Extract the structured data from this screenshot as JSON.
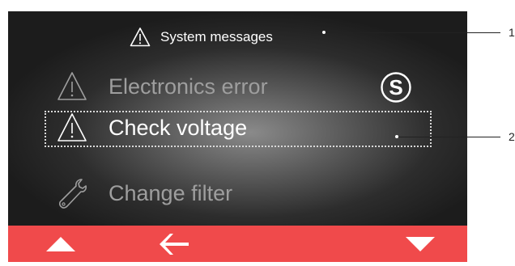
{
  "header": {
    "title": "System messages"
  },
  "messages": [
    {
      "label": "Electronics error",
      "icon": "warning-icon",
      "badge": "S",
      "selected": false
    },
    {
      "label": "Check voltage",
      "icon": "warning-icon",
      "selected": true
    },
    {
      "label": "Change filter",
      "icon": "wrench-icon",
      "selected": false
    }
  ],
  "footer": {
    "buttons": [
      {
        "name": "up-arrow-icon"
      },
      {
        "name": "back-arrow-icon"
      },
      {
        "name": "down-arrow-icon"
      }
    ]
  },
  "callouts": [
    "1",
    "2"
  ],
  "colors": {
    "accent": "#f04a4b",
    "text_selected": "#ffffff",
    "text_dim": "#9e9e9e"
  }
}
